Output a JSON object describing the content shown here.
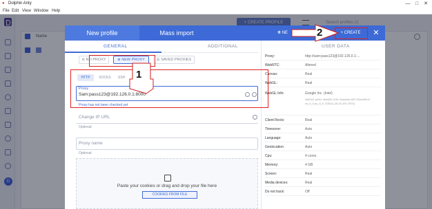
{
  "window": {
    "title": "Dolphin Anty",
    "controls": [
      "—",
      "□",
      "✕"
    ]
  },
  "menu": [
    "File",
    "Edit",
    "View",
    "Window",
    "Help"
  ],
  "background": {
    "create_label": "+ CREATE PROFILE",
    "search_placeholder": "Search profiles (/)",
    "name_header": "Name",
    "avatar_letter": "D"
  },
  "modal": {
    "tab_new_profile": "New profile",
    "tab_mass_import": "Mass import",
    "new_label": "NE",
    "create_label": "+ CREATE",
    "close": "✕",
    "subtabs": [
      "GENERAL",
      "ADDITIONAL"
    ],
    "proxy_buttons": [
      "NO PROXY",
      "NEW PROXY",
      "SAVED PROXIES"
    ],
    "protocols": [
      "HTTP",
      "SOCKS",
      "SSH"
    ],
    "proxy": {
      "label": "Proxy",
      "value": "Sam:pass123@192.126.0.1:8000",
      "hint": "Proxy has not been checked yet"
    },
    "change_ip": {
      "placeholder": "Change IP URL",
      "hint": "Optional"
    },
    "proxy_name": {
      "placeholder": "Proxy name",
      "hint": "Optional"
    },
    "drop": {
      "icon": "paste-icon",
      "text": "Paste your cookies or drag and drop your file here",
      "button": "COOKIES FROM FILE"
    }
  },
  "info_panel": {
    "heading": "USER DATA",
    "rows": [
      {
        "key": "Proxy:",
        "value": "http://sam:pass123@192.126.0.1:..."
      },
      {
        "key": "WebRTC:",
        "value": "Altered"
      },
      {
        "key": "Canvas:",
        "value": "Real"
      },
      {
        "key": "WebGL:",
        "value": "Real"
      },
      {
        "key": "WebGL Info:",
        "value": "Google Inc. (Intel)",
        "sub": "ANGLE (Intel, Intel(R) UHD Graphics 620 Direct3D11 vs_5_0 ps_5_0, D3D11-26.20.100.7870)"
      },
      {
        "key": "Client Rects:",
        "value": "Real"
      },
      {
        "key": "Timezone:",
        "value": "Auto"
      },
      {
        "key": "Language:",
        "value": "Auto"
      },
      {
        "key": "Geolocation:",
        "value": "Auto"
      },
      {
        "key": "Cpu:",
        "value": "4 cores"
      },
      {
        "key": "Memory:",
        "value": "4 GB"
      },
      {
        "key": "Screen:",
        "value": "Real"
      },
      {
        "key": "Media devices:",
        "value": "Real"
      },
      {
        "key": "Do not track:",
        "value": "Off"
      }
    ]
  },
  "annotations": {
    "step1": "1",
    "step2": "2"
  },
  "colors": {
    "accent": "#3d6ad6",
    "annotation": "#e02020"
  }
}
